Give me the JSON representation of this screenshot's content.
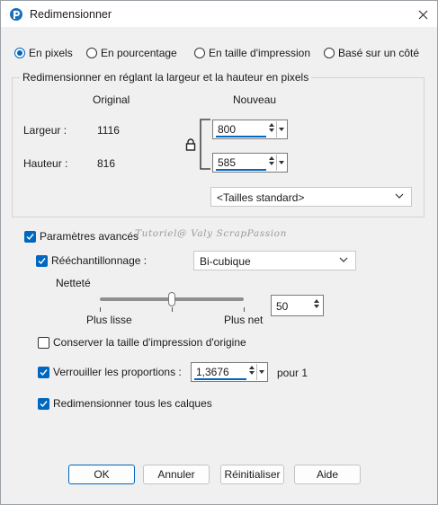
{
  "window": {
    "title": "Redimensionner",
    "close_icon": "close-icon",
    "app_icon": "paintshop-icon"
  },
  "mode": {
    "options": [
      {
        "label": "En pixels",
        "selected": true
      },
      {
        "label": "En pourcentage",
        "selected": false
      },
      {
        "label": "En taille d'impression",
        "selected": false
      },
      {
        "label": "Basé sur un côté",
        "selected": false
      }
    ]
  },
  "pixels_group": {
    "title": "Redimensionner en réglant la largeur et la hauteur en pixels",
    "col_original": "Original",
    "col_new": "Nouveau",
    "width_label": "Largeur :",
    "width_original": "1116",
    "width_new": "800",
    "height_label": "Hauteur :",
    "height_original": "816",
    "height_new": "585",
    "standard_sizes": "<Tailles standard>",
    "lock_icon": "lock-icon"
  },
  "advanced": {
    "label": "Paramètres avancés",
    "checked": true,
    "watermark": "Tutoriel@ Valy ScrapPassion",
    "resample_label": "Rééchantillonnage :",
    "resample_checked": true,
    "resample_value": "Bi-cubique",
    "sharpness_label": "Netteté",
    "slider_min_label": "Plus lisse",
    "slider_max_label": "Plus net",
    "sharpness_value": "50",
    "sharpness_level": 0.5,
    "keep_print_size_label": "Conserver la taille d'impression d'origine",
    "keep_print_size_checked": false,
    "lock_ratio_label": "Verrouiller les proportions :",
    "lock_ratio_checked": true,
    "ratio_value": "1,3676",
    "ratio_suffix": "pour 1",
    "resize_all_layers_label": "Redimensionner tous les calques",
    "resize_all_layers_checked": true
  },
  "buttons": {
    "ok": "OK",
    "cancel": "Annuler",
    "reset": "Réinitialiser",
    "help": "Aide"
  },
  "colors": {
    "accent": "#0067c0",
    "background": "#f0f0f0"
  }
}
